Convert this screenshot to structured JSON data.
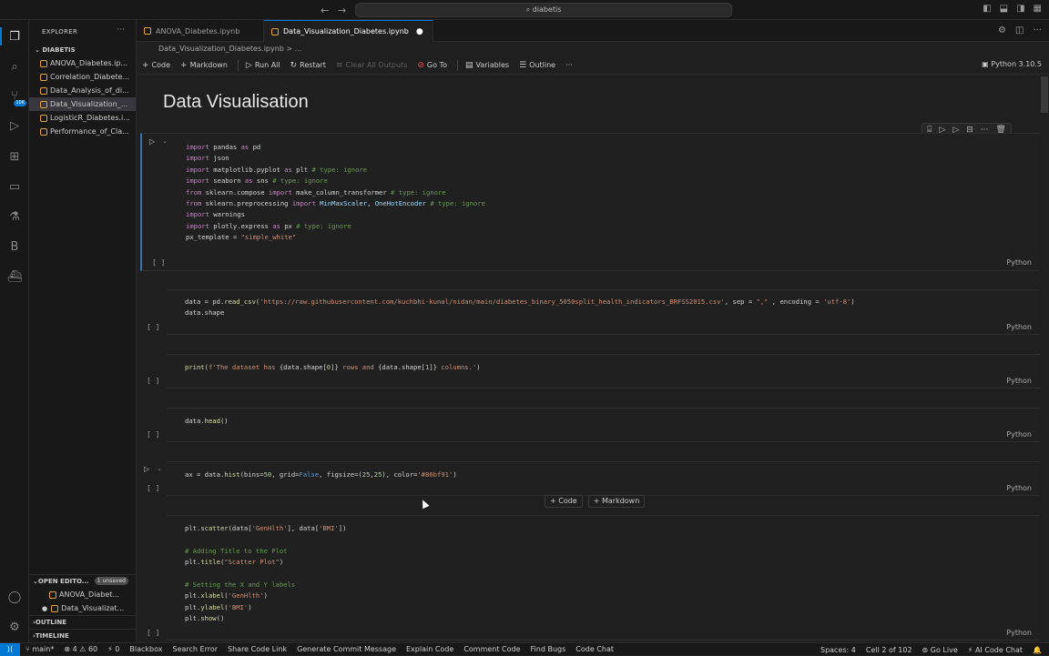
{
  "window": {
    "search": "diabetis"
  },
  "sidebar": {
    "header": "EXPLORER",
    "folder": "DIABETIS",
    "files": [
      "ANOVA_Diabetes.ip...",
      "Correlation_Diabete...",
      "Data_Analysis_of_di...",
      "Data_Visualization_...",
      "LogisticR_Diabetes.i...",
      "Performance_of_Cla..."
    ],
    "open_editors": "OPEN EDITO...",
    "unsaved": "1 unsaved",
    "open_files": [
      "ANOVA_Diabet...",
      "Data_Visualizat..."
    ],
    "outline": "OUTLINE",
    "timeline": "TIMELINE",
    "scm_badge": "10K"
  },
  "tabs": [
    {
      "label": "ANOVA_Diabetes.ipynb"
    },
    {
      "label": "Data_Visualization_Diabetes.ipynb"
    }
  ],
  "breadcrumb": "Data_Visualization_Diabetes.ipynb > ...",
  "toolbar": {
    "code": "Code",
    "markdown": "Markdown",
    "run_all": "Run All",
    "restart": "Restart",
    "clear": "Clear All Outputs",
    "goto": "Go To",
    "variables": "Variables",
    "outline": "Outline",
    "kernel": "Python 3.10.5"
  },
  "notebook": {
    "title": "Data Visualisation",
    "lang": "Python",
    "exec_label": "[ ]",
    "insert_code": "Code",
    "insert_markdown": "Markdown"
  },
  "status": {
    "branch": "main*",
    "problems": "⊗ 4 ⚠ 60",
    "ports": "⚡ 0",
    "items": [
      "Blackbox",
      "Search Error",
      "Share Code Link",
      "Generate Commit Message",
      "Explain Code",
      "Comment Code",
      "Find Bugs",
      "Code Chat"
    ],
    "spaces": "Spaces: 4",
    "cell": "Cell 2 of 102",
    "golive": "Go Live",
    "ai": "AI Code Chat"
  }
}
